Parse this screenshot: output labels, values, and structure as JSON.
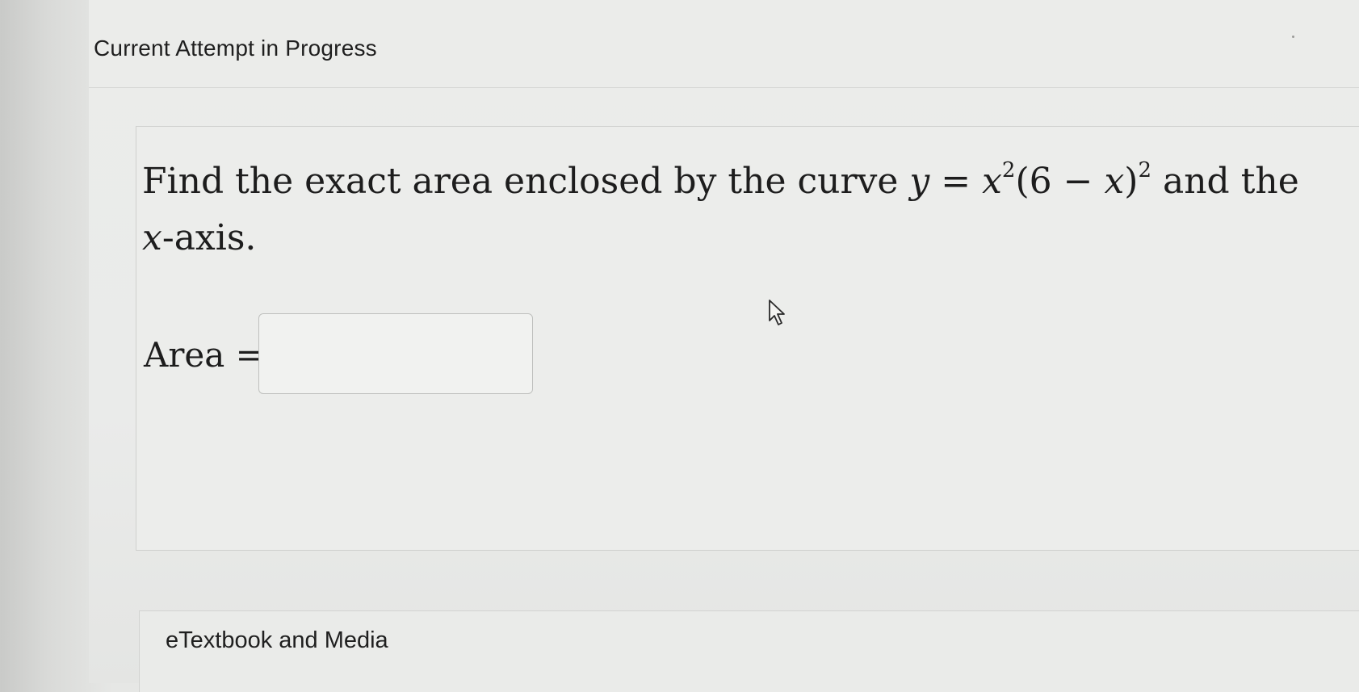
{
  "header": {
    "title": "Current Attempt in Progress"
  },
  "question": {
    "prefix": "Find the exact area enclosed by the curve ",
    "eq_y": "y",
    "eq_equals": " = ",
    "eq_x": "x",
    "eq_exp1": "2",
    "eq_paren_open": "(6 − ",
    "eq_x2": "x",
    "eq_paren_close": ")",
    "eq_exp2": "2",
    "suffix": " and the",
    "line2_var": "x",
    "line2_rest": "-axis."
  },
  "answer": {
    "label": "Area =",
    "value": "",
    "placeholder": ""
  },
  "footer": {
    "etextbook_label": "eTextbook and Media"
  },
  "icons": {
    "cursor": "mouse-pointer-icon"
  }
}
